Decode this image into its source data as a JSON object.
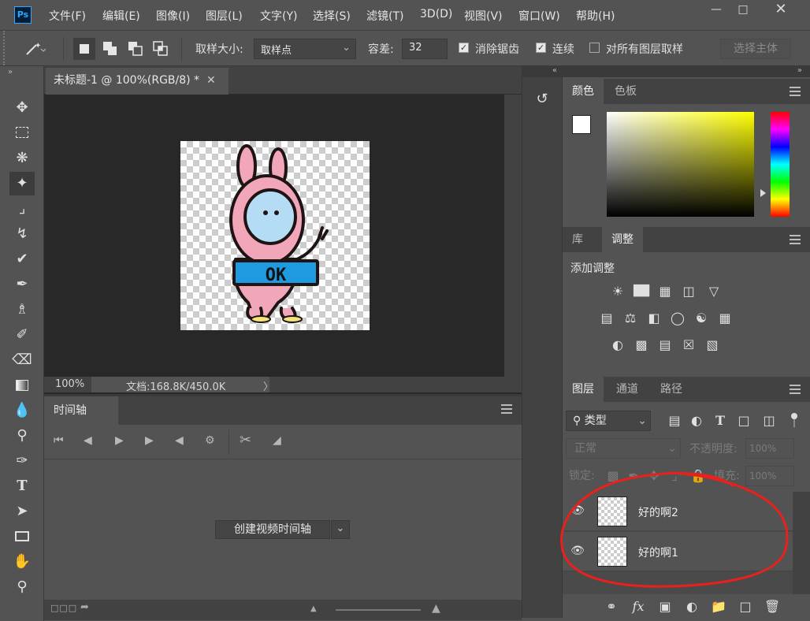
{
  "app": {
    "logo": "Ps"
  },
  "menubar": {
    "items": [
      "文件(F)",
      "编辑(E)",
      "图像(I)",
      "图层(L)",
      "文字(Y)",
      "选择(S)",
      "滤镜(T)",
      "3D(D)",
      "视图(V)",
      "窗口(W)",
      "帮助(H)"
    ],
    "window_controls": [
      "minimize-icon",
      "restore-icon",
      "close-icon"
    ]
  },
  "options": {
    "sample_size_label": "取样大小:",
    "sample_size_value": "取样点",
    "tolerance_label": "容差:",
    "tolerance_value": "32",
    "antialias_label": "消除锯齿",
    "antialias_checked": true,
    "contiguous_label": "连续",
    "contiguous_checked": true,
    "all_layers_label": "对所有图层取样",
    "all_layers_checked": false,
    "select_subject_label": "选择主体"
  },
  "document": {
    "tab_title": "未标题-1 @ 100%(RGB/8) *",
    "zoom": "100%",
    "doc_info": "文档:168.8K/450.0K",
    "artwork_text": "OK"
  },
  "timeline": {
    "tab_label": "时间轴",
    "create_button_label": "创建视频时间轴"
  },
  "color_panel": {
    "tabs": [
      "颜色",
      "色板"
    ],
    "active_tab": 0
  },
  "adjustments_panel": {
    "tabs": [
      "库",
      "调整"
    ],
    "active_tab": 1,
    "heading": "添加调整"
  },
  "layers_panel": {
    "tabs": [
      "图层",
      "通道",
      "路径"
    ],
    "active_tab": 0,
    "filter_label": "类型",
    "blend_mode": "正常",
    "opacity_label": "不透明度:",
    "opacity_value": "100%",
    "lock_label": "锁定:",
    "fill_label": "填充:",
    "fill_value": "100%",
    "layers": [
      {
        "name": "好的啊2",
        "visible": true
      },
      {
        "name": "好的啊1",
        "visible": true
      }
    ],
    "annotation_color": "#e8211d"
  }
}
